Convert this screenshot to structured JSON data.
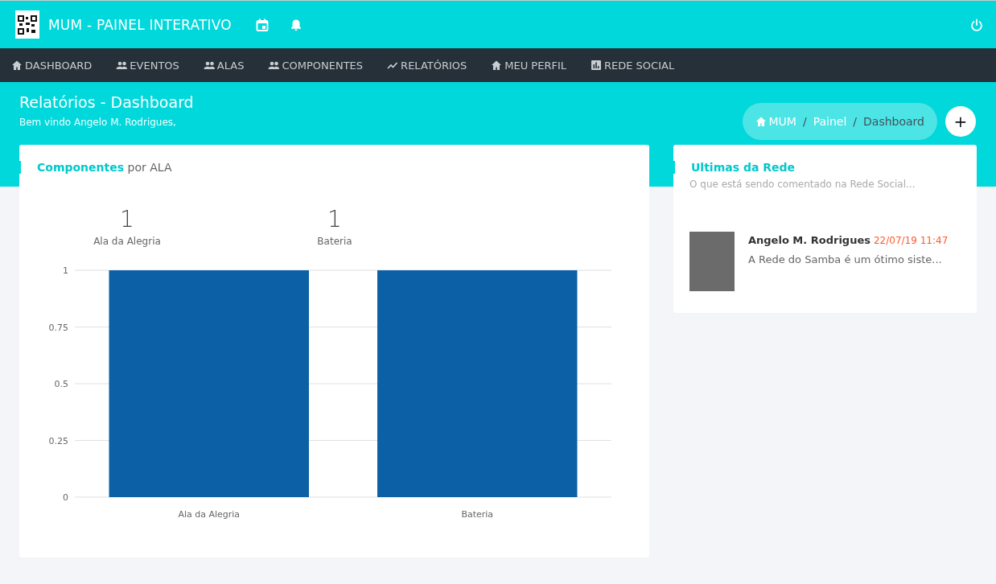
{
  "header": {
    "title": "MUM - PAINEL INTERATIVO"
  },
  "nav": [
    {
      "label": "DASHBOARD",
      "kind": "home"
    },
    {
      "label": "EVENTOS",
      "kind": "people"
    },
    {
      "label": "ALAS",
      "kind": "people"
    },
    {
      "label": "COMPONENTES",
      "kind": "people"
    },
    {
      "label": "RELATÓRIOS",
      "kind": "trend"
    },
    {
      "label": "MEU PERFIL",
      "kind": "home"
    },
    {
      "label": "REDE SOCIAL",
      "kind": "chart"
    }
  ],
  "page": {
    "title": "Relatórios - Dashboard",
    "subtitle": "Bem vindo Angelo M. Rodrigues,"
  },
  "breadcrumb": [
    {
      "label": "MUM",
      "current": false
    },
    {
      "label": "Painel",
      "current": false
    },
    {
      "label": "Dashboard",
      "current": true
    }
  ],
  "breadcrumb_separator": "/",
  "add_button": "+",
  "components_card": {
    "title": "**Componentes** por ALA",
    "stats": [
      {
        "value": "1",
        "label": "Ala da Alegria"
      },
      {
        "value": "1",
        "label": "Bateria"
      }
    ],
    "chart_data": {
      "type": "bar",
      "categories": [
        "Ala da Alegria",
        "Bateria"
      ],
      "series": [
        {
          "color": "#0c60a5",
          "values": [
            1,
            1
          ]
        }
      ],
      "grid": true,
      "ylim": [
        0,
        1
      ],
      "yticks": [
        0,
        0.25,
        0.5,
        0.75,
        1
      ]
    }
  },
  "social_card": {
    "title": "Ultimas da Rede",
    "subtitle": "O que está sendo comentado na Rede Social...",
    "posts": [
      {
        "author": "Angelo M. Rodrigues",
        "time": "22/07/19 11:47",
        "text": "A Rede do Samba é um ótimo siste..."
      }
    ]
  }
}
